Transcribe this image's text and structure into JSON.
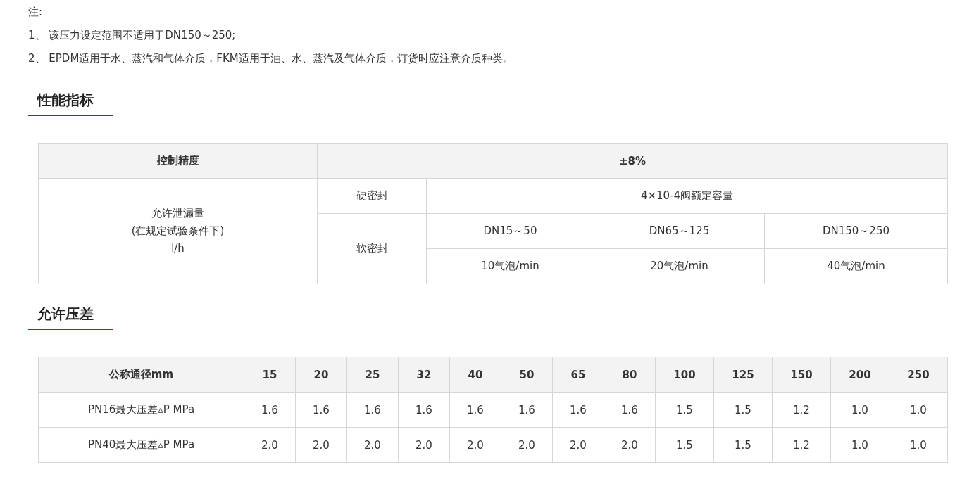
{
  "notes": {
    "label": "注:",
    "items": [
      "1、 该压力设定范围不适用于DN150～250;",
      "2、 EPDM适用于水、蒸汽和气体介质，FKM适用于油、水、蒸汽及气体介质，订货时应注意介质种类。"
    ]
  },
  "performance": {
    "title": "性能指标",
    "control_precision": {
      "label": "控制精度",
      "value": "±8%"
    },
    "leakage": {
      "label": "允许泄漏量\n(在规定试验条件下)\nl/h",
      "hard_seal": {
        "label": "硬密封",
        "value": "4×10-4阀额定容量"
      },
      "soft_seal": {
        "label": "软密封",
        "sizes": [
          "DN15～50",
          "DN65～125",
          "DN150～250"
        ],
        "values": [
          "10气泡/min",
          "20气泡/min",
          "40气泡/min"
        ]
      }
    }
  },
  "pressure_difference": {
    "title": "允许压差",
    "columns": [
      "公称通径mm",
      "15",
      "20",
      "25",
      "32",
      "40",
      "50",
      "65",
      "80",
      "100",
      "125",
      "150",
      "200",
      "250"
    ],
    "rows": [
      {
        "label": "PN16最大压差▵P MPa",
        "values": [
          "1.6",
          "1.6",
          "1.6",
          "1.6",
          "1.6",
          "1.6",
          "1.6",
          "1.6",
          "1.5",
          "1.5",
          "1.2",
          "1.0",
          "1.0"
        ]
      },
      {
        "label": "PN40最大压差▵P MPa",
        "values": [
          "2.0",
          "2.0",
          "2.0",
          "2.0",
          "2.0",
          "2.0",
          "2.0",
          "2.0",
          "1.5",
          "1.5",
          "1.2",
          "1.0",
          "1.0"
        ]
      }
    ]
  }
}
